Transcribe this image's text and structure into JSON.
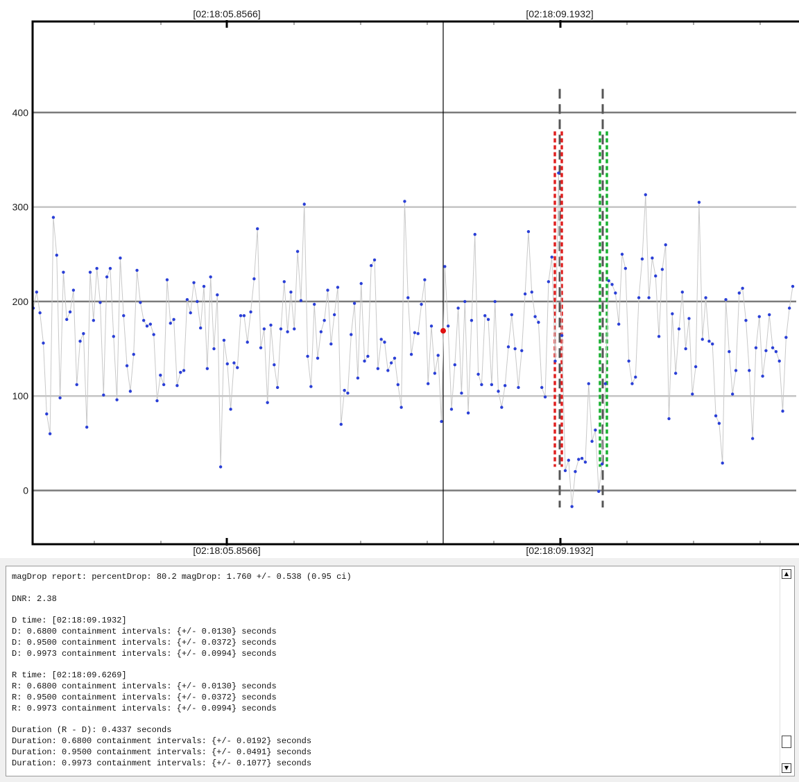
{
  "chart_data": {
    "type": "scatter",
    "y_ticks": [
      0,
      100,
      200,
      300,
      400
    ],
    "ylim": [
      -55,
      495
    ],
    "time_labels": [
      "[02:18:05.8566]",
      "[02:18:09.1932]"
    ],
    "colors": {
      "points": "#2a3fd6",
      "connector": "#c8c8c8",
      "red_marker": "#e01010",
      "d_edge": "#e02020",
      "r_edge": "#18b030",
      "edge_guides": "#555555"
    },
    "observation_values": [
      193,
      210,
      188,
      156,
      81,
      60,
      289,
      249,
      98,
      231,
      181,
      189,
      212,
      112,
      158,
      166,
      67,
      231,
      180,
      235,
      199,
      101,
      226,
      235,
      163,
      96,
      246,
      185,
      132,
      105,
      144,
      233,
      199,
      180,
      174,
      176,
      165,
      95,
      122,
      112,
      223,
      177,
      181,
      111,
      125,
      127,
      202,
      188,
      220,
      200,
      172,
      216,
      129,
      226,
      150,
      207,
      25,
      159,
      134,
      86,
      135,
      130,
      185,
      185,
      157,
      189,
      224,
      277,
      151,
      171,
      93,
      175,
      133,
      109,
      171,
      221,
      168,
      210,
      171,
      253,
      201,
      303,
      142,
      110,
      197,
      140,
      168,
      180,
      212,
      155,
      186,
      215,
      70,
      106,
      103,
      165,
      198,
      119,
      219,
      137,
      142,
      238,
      244,
      129,
      160,
      157,
      127,
      135,
      140,
      112,
      88,
      306,
      204,
      144,
      167,
      166,
      197,
      223,
      113,
      174,
      124,
      143,
      73,
      237,
      174,
      86,
      133,
      193,
      103,
      200,
      82,
      180,
      271,
      123,
      112,
      185,
      181,
      112,
      200,
      105,
      88,
      111,
      152,
      186,
      150,
      109,
      148,
      208,
      274,
      210,
      184,
      178,
      109,
      99,
      221,
      247,
      137,
      336,
      164,
      21,
      32,
      -17,
      20,
      33,
      34,
      30,
      113,
      52,
      64,
      -1,
      28,
      113,
      222,
      218,
      209,
      176,
      250,
      235,
      137,
      113,
      120,
      204,
      245,
      313,
      204,
      246,
      227,
      163,
      234,
      260,
      76,
      187,
      124,
      171,
      210,
      150,
      182,
      102,
      131,
      305,
      160,
      204,
      158,
      155,
      79,
      71,
      29,
      202,
      147,
      102,
      127,
      209,
      214,
      180,
      127,
      55,
      151,
      184,
      121,
      148,
      186,
      151,
      147,
      137,
      84,
      162,
      193,
      216
    ],
    "red_marker_value": 169,
    "d_edge_range": [
      25,
      380
    ],
    "r_edge_range": [
      25,
      380
    ]
  },
  "report": {
    "lines": [
      "magDrop report: percentDrop: 80.2 magDrop: 1.760 +/- 0.538 (0.95 ci)",
      "",
      "DNR: 2.38",
      "",
      "D time: [02:18:09.1932]",
      "D: 0.6800 containment intervals: {+/- 0.0130} seconds",
      "D: 0.9500 containment intervals: {+/- 0.0372} seconds",
      "D: 0.9973 containment intervals: {+/- 0.0994} seconds",
      "",
      "R time: [02:18:09.6269]",
      "R: 0.6800 containment intervals: {+/- 0.0130} seconds",
      "R: 0.9500 containment intervals: {+/- 0.0372} seconds",
      "R: 0.9973 containment intervals: {+/- 0.0994} seconds",
      "",
      "Duration (R - D): 0.4337 seconds",
      "Duration: 0.6800 containment intervals: {+/- 0.0192} seconds",
      "Duration: 0.9500 containment intervals: {+/- 0.0491} seconds",
      "Duration: 0.9973 containment intervals: {+/- 0.1077} seconds"
    ],
    "scroll_up_glyph": "▲",
    "scroll_down_glyph": "▼"
  }
}
